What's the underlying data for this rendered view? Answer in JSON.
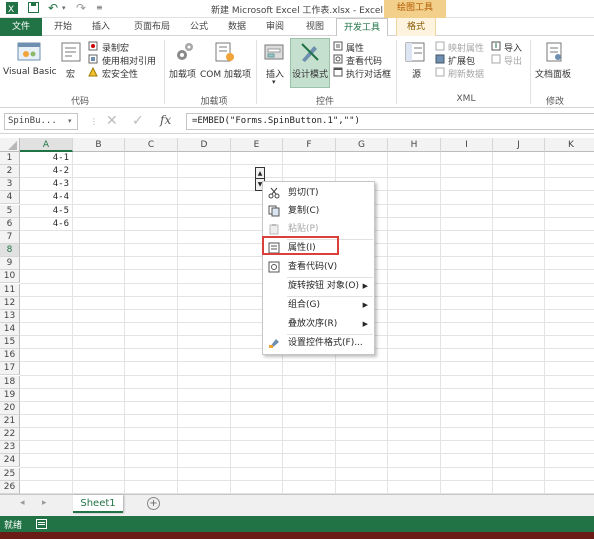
{
  "title_bar": {
    "title": "新建 Microsoft Excel 工作表.xlsx - Excel",
    "context_tab_group": "绘图工具",
    "qat": [
      "save-icon",
      "undo-icon",
      "redo-icon",
      "customize-icon"
    ]
  },
  "tabs": [
    "文件",
    "开始",
    "插入",
    "页面布局",
    "公式",
    "数据",
    "审阅",
    "视图",
    "开发工具",
    "格式"
  ],
  "active_tab": "开发工具",
  "ribbon": {
    "code": {
      "group_label": "代码",
      "visual_basic": "Visual Basic",
      "macro": "宏",
      "record_macro": "录制宏",
      "relative_ref": "使用相对引用",
      "macro_security": "宏安全性"
    },
    "addins": {
      "group_label": "加载项",
      "addins": "加载项",
      "com_addins": "COM 加载项"
    },
    "controls": {
      "group_label": "控件",
      "insert": "插入",
      "design_mode": "设计模式",
      "properties": "属性",
      "view_code": "查看代码",
      "run_dialog": "执行对话框"
    },
    "xml": {
      "group_label": "XML",
      "source": "源",
      "map_props": "映射属性",
      "expansion": "扩展包",
      "refresh": "刷新数据",
      "import": "导入",
      "export": "导出"
    },
    "modify": {
      "group_label": "修改",
      "doc_panel": "文档面板"
    }
  },
  "formula_bar": {
    "name_box": "SpinBu...",
    "formula": "=EMBED(\"Forms.SpinButton.1\",\"\")",
    "fx": "fx"
  },
  "columns": [
    "A",
    "B",
    "C",
    "D",
    "E",
    "F",
    "G",
    "H",
    "I",
    "J",
    "K"
  ],
  "rows": [
    "1",
    "2",
    "3",
    "4",
    "5",
    "6",
    "7",
    "8",
    "9",
    "10",
    "11",
    "12",
    "13",
    "14",
    "15",
    "16",
    "17",
    "18",
    "19",
    "20",
    "21",
    "22",
    "23",
    "24",
    "25",
    "26"
  ],
  "selected_column": "A",
  "selected_row": "8",
  "cells_a": [
    "4-1",
    "4-2",
    "4-3",
    "4-4",
    "4-5",
    "4-6"
  ],
  "context_menu": {
    "cut": "剪切(T)",
    "copy": "复制(C)",
    "paste": "粘贴(P)",
    "properties": "属性(I)",
    "view_code": "查看代码(V)",
    "spin_object": "旋转按钮 对象(O)",
    "group": "组合(G)",
    "order": "叠放次序(R)",
    "format_control": "设置控件格式(F)..."
  },
  "sheet_tabs": [
    "Sheet1"
  ],
  "status": "就绪",
  "colors": {
    "excel_green": "#217346",
    "highlight_red": "#d9403a"
  }
}
